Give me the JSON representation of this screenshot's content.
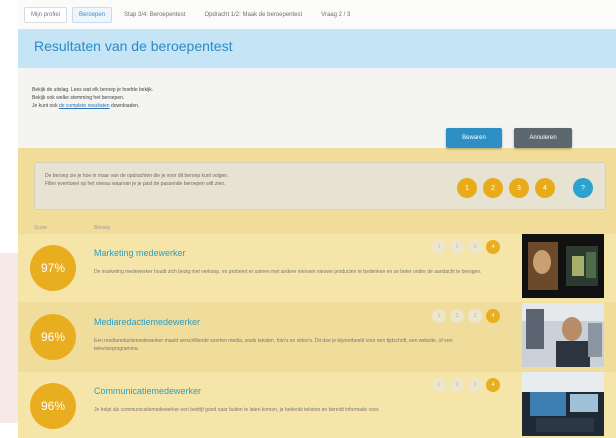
{
  "nav": {
    "crumbs": [
      "Mijn profiel",
      "Beroepen",
      "Stap 3/4: Beroepentest",
      "Opdracht 1/2: Maak de beroepentest",
      "Vraag 2 / 3"
    ]
  },
  "page": {
    "title": "Resultaten van de beroepentest",
    "intro_line1": "Bekijk de uitslag. Lees wat elk beroep je hoefde bekijk.",
    "intro_line2": "Bekijk ook welke stemming het beroepen.",
    "intro_prefix": "Je kunt ook",
    "intro_link": "de complete resultaten",
    "intro_suffix": "downloaden."
  },
  "actions": {
    "save_label": "Bewaren",
    "close_label": "Annuleren"
  },
  "filter": {
    "line1": "De beroep zie je hoe in maar van de opdrachten die je voor dit beroep kunt volgen.",
    "line2": "Filter eventueel op het niveau waarvan je je past de passende beroepen wilt zien.",
    "levels": [
      "1",
      "2",
      "3",
      "4"
    ],
    "help": "?"
  },
  "columns": {
    "score": "Score",
    "beroep": "Beroep"
  },
  "results": [
    {
      "score": "97%",
      "title": "Marketing medewerker",
      "desc": "De marketing medewerker houdt zich bezig met verkoop, en probeert er samen met andere mensen nieuwe producten te bedenken en ze beter onder de aandacht te brengen.",
      "level": "4"
    },
    {
      "score": "96%",
      "title": "Mediaredactiemedewerker",
      "desc": "Een mediaredactiemedewerker maakt verschillende soorten media, zoals teksten, foto's en video's. Dit doe je bijvoorbeeld voor een tijdschrift, een website, of een televisieprogramma.",
      "level": "4"
    },
    {
      "score": "96%",
      "title": "Communicatiemedewerker",
      "desc": "Je helpt als communicatiemedewerker een bedrijf goed naar buiten te laten komen, je bedenkt teksten en bereidt informatie voor.",
      "level": "4"
    }
  ],
  "star_labels": [
    "1",
    "2",
    "3"
  ]
}
